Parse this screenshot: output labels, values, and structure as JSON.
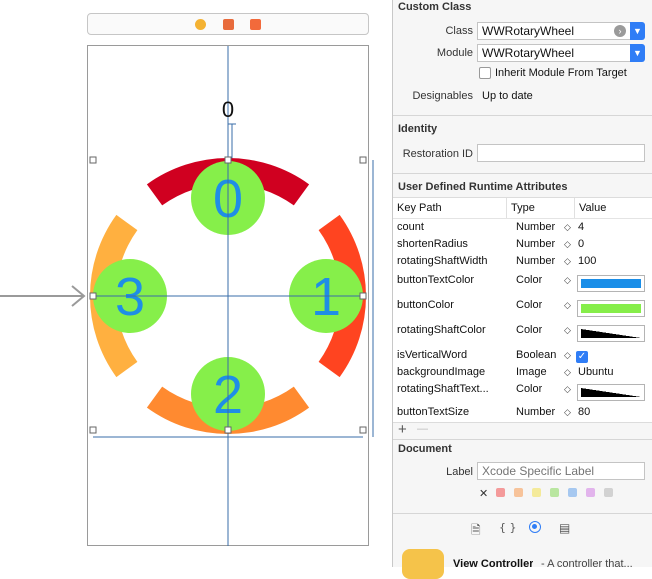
{
  "canvas": {
    "wheel": {
      "labels": [
        "0",
        "1",
        "2",
        "3"
      ],
      "top_label": "0",
      "segment_colors": [
        "#d00020",
        "#ff4420",
        "#ff8a30",
        "#ffb040"
      ],
      "button_color": "#86ef4a",
      "text_color": "#1f8ee6"
    }
  },
  "inspector": {
    "custom_class": {
      "title": "Custom Class",
      "class_label": "Class",
      "class_value": "WWRotaryWheel",
      "module_label": "Module",
      "module_value": "WWRotaryWheel",
      "inherit_label": "Inherit Module From Target",
      "designables_label": "Designables",
      "designables_value": "Up to date"
    },
    "identity": {
      "title": "Identity",
      "restoration_label": "Restoration ID",
      "restoration_value": ""
    },
    "runtime_attributes": {
      "title": "User Defined Runtime Attributes",
      "headers": [
        "Key Path",
        "Type",
        "Value"
      ],
      "rows": [
        {
          "key": "count",
          "type": "Number",
          "value": "4"
        },
        {
          "key": "shortenRadius",
          "type": "Number",
          "value": "0"
        },
        {
          "key": "rotatingShaftWidth",
          "type": "Number",
          "value": "100"
        },
        {
          "key": "buttonTextColor",
          "type": "Color",
          "value": "",
          "color": "#1a8ee8"
        },
        {
          "key": "buttonColor",
          "type": "Color",
          "value": "",
          "color": "#86ee4a"
        },
        {
          "key": "rotatingShaftColor",
          "type": "Color",
          "value": "",
          "color": "black-gradient"
        },
        {
          "key": "isVerticalWord",
          "type": "Boolean",
          "value": "",
          "checked": true
        },
        {
          "key": "backgroundImage",
          "type": "Image",
          "value": "Ubuntu"
        },
        {
          "key": "rotatingShaftText...",
          "type": "Color",
          "value": "",
          "color": "black-gradient"
        },
        {
          "key": "buttonTextSize",
          "type": "Number",
          "value": "80"
        }
      ],
      "add_label": "+",
      "remove_label": "—"
    },
    "document": {
      "title": "Document",
      "label_label": "Label",
      "label_placeholder": "Xcode Specific Label",
      "remove_color_label": "✕",
      "label_colors": [
        "#f49a9a",
        "#f7c39a",
        "#f4ea9a",
        "#b9e6a0",
        "#a6c8f0",
        "#e2b4ec",
        "#d2d2d2"
      ]
    },
    "tabs": [
      "file-icon",
      "braces-icon",
      "identity-icon",
      "library-icon"
    ],
    "library": {
      "item_title": "View Controller",
      "item_desc": "- A controller that..."
    }
  }
}
